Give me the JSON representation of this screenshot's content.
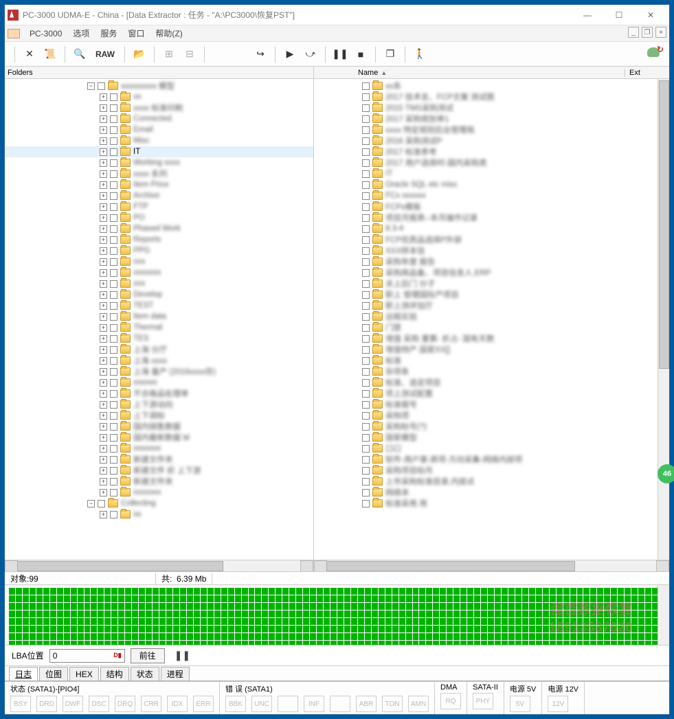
{
  "window": {
    "title": "PC-3000 UDMA-E - China - [Data Extractor : 任务 - \"A:\\PC3000\\恢复PST\"]"
  },
  "menubar": {
    "items": [
      "PC-3000",
      "选项",
      "服务",
      "窗口",
      "帮助(Z)"
    ]
  },
  "toolbar": {
    "raw_label": "RAW"
  },
  "left_pane": {
    "header": "Folders",
    "tree": [
      {
        "depth": 0,
        "exp": "-",
        "text": "xxxxxxxxx 模型"
      },
      {
        "depth": 1,
        "exp": "+",
        "text": "xx"
      },
      {
        "depth": 1,
        "exp": "+",
        "text": "xxxx 标准印刷"
      },
      {
        "depth": 1,
        "exp": "+",
        "text": "Connected"
      },
      {
        "depth": 1,
        "exp": "+",
        "text": "Email"
      },
      {
        "depth": 1,
        "exp": "+",
        "text": "Misc"
      },
      {
        "depth": 1,
        "exp": "+",
        "text": "IT",
        "selected": true,
        "clear": true
      },
      {
        "depth": 1,
        "exp": "+",
        "text": "Working xxxx"
      },
      {
        "depth": 1,
        "exp": "+",
        "text": "xxxx 系列"
      },
      {
        "depth": 1,
        "exp": "+",
        "text": "Item Price"
      },
      {
        "depth": 1,
        "exp": "+",
        "text": "Archive"
      },
      {
        "depth": 1,
        "exp": "+",
        "text": "FTP"
      },
      {
        "depth": 1,
        "exp": "+",
        "text": "PO"
      },
      {
        "depth": 1,
        "exp": "+",
        "text": "Phased Work"
      },
      {
        "depth": 1,
        "exp": "+",
        "text": "Reports"
      },
      {
        "depth": 1,
        "exp": "+",
        "text": "PPG"
      },
      {
        "depth": 1,
        "exp": "+",
        "text": "xxx"
      },
      {
        "depth": 1,
        "exp": "+",
        "text": "xxxxxxx"
      },
      {
        "depth": 1,
        "exp": "+",
        "text": "xxx"
      },
      {
        "depth": 1,
        "exp": "+",
        "text": "Develop"
      },
      {
        "depth": 1,
        "exp": "+",
        "text": "TEST"
      },
      {
        "depth": 1,
        "exp": "+",
        "text": "Item data"
      },
      {
        "depth": 1,
        "exp": "+",
        "text": "Thermal"
      },
      {
        "depth": 1,
        "exp": "+",
        "text": "TES"
      },
      {
        "depth": 1,
        "exp": "+",
        "text": "上海 分厅"
      },
      {
        "depth": 1,
        "exp": "+",
        "text": "上海 xxxx"
      },
      {
        "depth": 1,
        "exp": "+",
        "text": "上海 量产 (2016xxxx存)"
      },
      {
        "depth": 1,
        "exp": "+",
        "text": "xxxxxx"
      },
      {
        "depth": 1,
        "exp": "+",
        "text": "不合格品处理单"
      },
      {
        "depth": 1,
        "exp": "+",
        "text": "上下游动向"
      },
      {
        "depth": 1,
        "exp": "+",
        "text": "上下调标"
      },
      {
        "depth": 1,
        "exp": "+",
        "text": "国内销售数据"
      },
      {
        "depth": 1,
        "exp": "+",
        "text": "国内最新数据 M"
      },
      {
        "depth": 1,
        "exp": "+",
        "text": "xxxxxxx"
      },
      {
        "depth": 1,
        "exp": "+",
        "text": "新建文件夹"
      },
      {
        "depth": 1,
        "exp": "+",
        "text": "新建文件 折 上下游"
      },
      {
        "depth": 1,
        "exp": "+",
        "text": "新建文件夹"
      },
      {
        "depth": 1,
        "exp": "+",
        "text": "xxxxxxx"
      },
      {
        "depth": 0,
        "exp": "-",
        "text": "Collecting"
      },
      {
        "depth": 1,
        "exp": "+",
        "text": "xx"
      }
    ]
  },
  "right_pane": {
    "columns": {
      "name": "Name",
      "ext": "Ext"
    },
    "items": [
      "xx系",
      "2017 技术支、FCP文案 测试图",
      "2015 TMS采购测试",
      "2017 采购规划单1",
      "xxxx 特定规则后台管理局",
      "2016 采购测试P",
      "2017 标准参考",
      "2017 用户选择时-国内采购类",
      "IT",
      "Oracle SQL etc misc",
      "FCx xxxxxx",
      "FCPx模板",
      "项目月报表--本月操作记录",
      "8.3-4",
      "FCP优质品选择P外部",
      "XXX样本信",
      "采购年度 报告",
      "采购商品备、项目信息人.ERP",
      "关上后门 分子",
      "职上 管理国际产项目",
      "职上测评加厅",
      "远程实验",
      "门禁",
      "增值 采购 重算- 折占- 国有天数",
      "增值特产 国家XX[]",
      "标准",
      "杂项条",
      "标准、选定项目",
      "项上测试配置",
      "标准报号",
      "采购项",
      "采购标号(?)",
      "国家模型",
      "口口",
      "软件-用户第-原项-方向采集-网络内部项",
      "采购项目标月",
      "上市采购标准目录,内部点",
      "网络本",
      "标准采用 用"
    ]
  },
  "status_mid": {
    "objects_label": "对象:",
    "objects_value": "99",
    "total_label": "共:",
    "total_value": "6.39 Mb"
  },
  "lba": {
    "label": "LBA位置",
    "value": "0",
    "go_btn": "前往"
  },
  "tabs": [
    "日志",
    "位图",
    "HEX",
    "结构",
    "状态",
    "进程"
  ],
  "active_tab": 0,
  "bottom_status": {
    "group1": {
      "title": "状态 (SATA1)-[PIO4]",
      "boxes": [
        "BSY",
        "DRD",
        "DWF",
        "DSC",
        "DRQ",
        "CRR",
        "IDX",
        "ERR"
      ]
    },
    "group2": {
      "title": "错 误 (SATA1)",
      "boxes": [
        "BBK",
        "UNC",
        "",
        "INF",
        "",
        "ABR",
        "TON",
        "AMN"
      ]
    },
    "group3": {
      "title": "DMA",
      "boxes": [
        "RQ"
      ]
    },
    "group4": {
      "title": "SATA-II",
      "boxes": [
        "PHY"
      ]
    },
    "group5": {
      "title": "电源 5V",
      "boxes": [
        "5V"
      ]
    },
    "group6": {
      "title": "电源 12V",
      "boxes": [
        "12V"
      ]
    }
  },
  "watermark": {
    "line1": "盘首数据恢复",
    "line2": "18913587620"
  },
  "badge": "46"
}
